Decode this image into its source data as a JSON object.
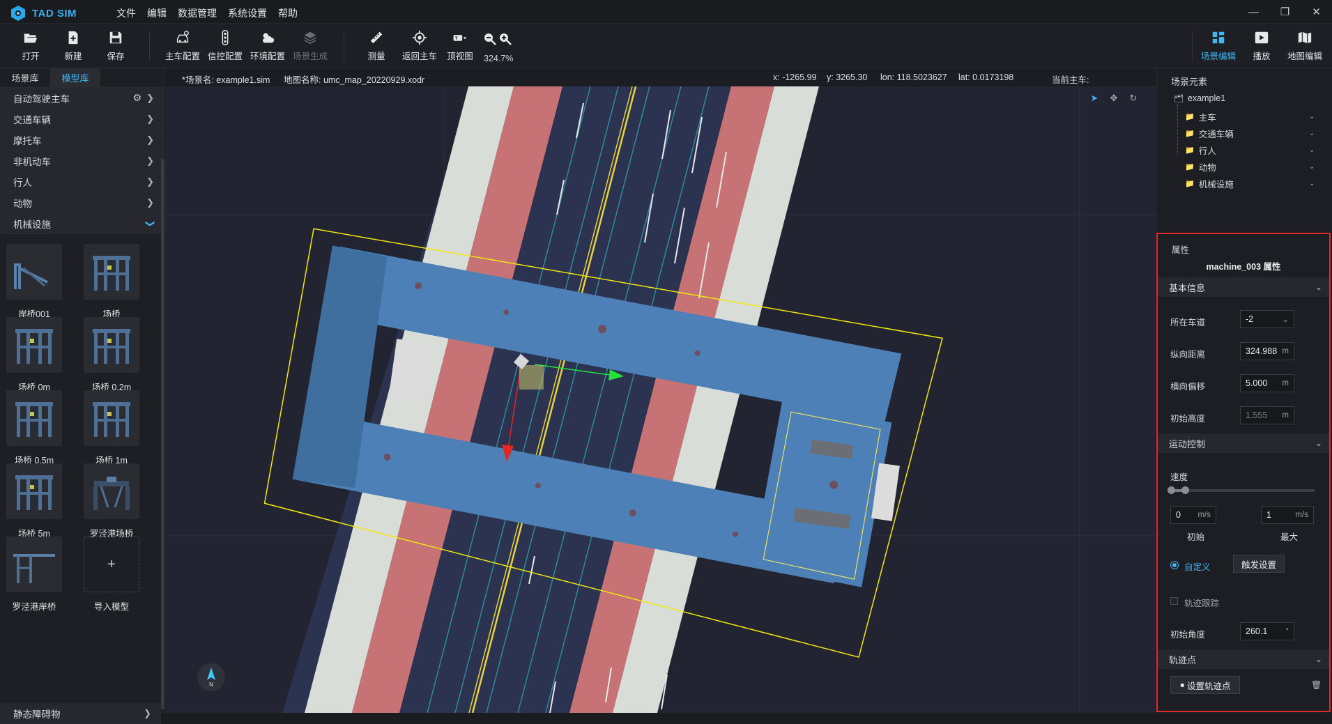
{
  "app": {
    "name": "TAD SIM"
  },
  "menu": [
    "文件",
    "编辑",
    "数据管理",
    "系统设置",
    "帮助"
  ],
  "toolbar": {
    "open": "打开",
    "new": "新建",
    "save": "保存",
    "ego_config": "主车配置",
    "signal_config": "信控配置",
    "env_config": "环境配置",
    "scene_gen": "场景生成",
    "measure": "测量",
    "return_ego": "返回主车",
    "top_view": "顶视图",
    "zoom": "324.7%",
    "scene_edit": "场景编辑",
    "play": "播放",
    "map_edit": "地图编辑"
  },
  "left": {
    "tabs": [
      "场景库",
      "模型库"
    ],
    "categories": [
      "自动驾驶主车",
      "交通车辆",
      "摩托车",
      "非机动车",
      "行人",
      "动物",
      "机械设施"
    ],
    "models": [
      "岸桥001",
      "场桥",
      "场桥 0m",
      "场桥 0.2m",
      "场桥 0.5m",
      "场桥 1m",
      "场桥 5m",
      "罗泾港场桥",
      "罗泾港岸桥",
      "导入模型"
    ],
    "next_category": "静态障碍物"
  },
  "viewport": {
    "scene_name": "*场景名: example1.sim",
    "map_name": "地图名称: umc_map_20220929.xodr",
    "x": "x: -1265.99",
    "y": "y: 3265.30",
    "lon": "lon: 118.5023627",
    "lat": "lat: 0.0173198",
    "current_ego": "当前主车:",
    "compass": "N"
  },
  "scene_tree": {
    "header": "场景元素",
    "root": "example1",
    "children": [
      "主车",
      "交通车辆",
      "行人",
      "动物",
      "机械设施"
    ]
  },
  "props": {
    "header": "属性",
    "title": "machine_003 属性",
    "basic": "基本信息",
    "lane_label": "所在车道",
    "lane_value": "-2",
    "long_label": "纵向距离",
    "long_value": "324.988",
    "lat_label": "横向偏移",
    "lat_value": "5.000",
    "height_label": "初始高度",
    "height_value": "1.555",
    "unit_m": "m",
    "motion": "运动控制",
    "speed_label": "速度",
    "speed_init": "0",
    "speed_max": "1",
    "unit_ms": "m/s",
    "init_label": "初始",
    "max_label": "最大",
    "custom_label": "自定义",
    "trigger_btn": "触发设置",
    "track_label": "轨迹跟踪",
    "angle_label": "初始角度",
    "angle_value": "260.1",
    "unit_deg": "°",
    "waypoints": "轨迹点",
    "set_waypoint_btn": "设置轨迹点"
  },
  "colors": {
    "accent": "#3fb6f5",
    "highlight": "#e0282a",
    "road": "#2b3350",
    "bike_lane": "#c77274",
    "sidewalk": "#d9ddd8",
    "selection": "#f2e90c"
  }
}
